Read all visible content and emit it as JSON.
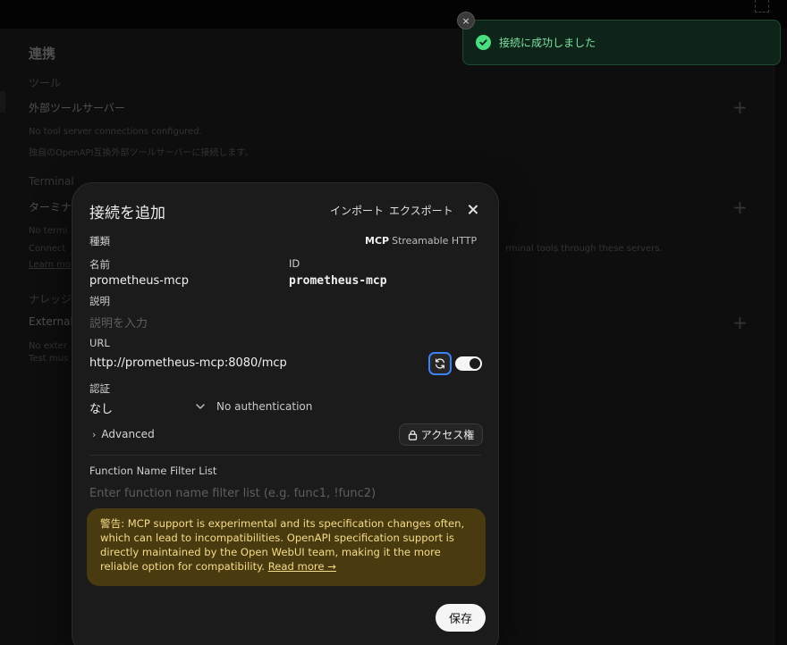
{
  "background": {
    "page_title": "連携",
    "section_tools": "ツール",
    "external_tool_servers_label": "外部ツールサーバー",
    "tools_empty": "No tool server connections configured.",
    "tools_desc": "独自のOpenAPI互換外部ツールサーバーに接続します。",
    "section_terminal": "Terminal",
    "terminal_label": "ターミナ",
    "terminal_empty": "No termi",
    "terminal_connect": "Connect",
    "terminal_desc_tail": "rminal tools through these servers.",
    "terminal_learn": "Learn mo",
    "section_knowledge": "ナレッジ",
    "external_label": "External",
    "external_empty": "No exter",
    "external_test": "Test mus"
  },
  "modal": {
    "title": "接続を追加",
    "import_label": "インポート",
    "export_label": "エクスポート",
    "type_label": "種類",
    "type_mcp": "MCP",
    "type_transport": "Streamable HTTP",
    "name_label": "名前",
    "name_value": "prometheus-mcp",
    "id_label": "ID",
    "id_value": "prometheus-mcp",
    "description_label": "説明",
    "description_placeholder": "説明を入力",
    "url_label": "URL",
    "url_value": "http://prometheus-mcp:8080/mcp",
    "url_enabled": true,
    "auth_label": "認証",
    "auth_value": "なし",
    "auth_detail": "No authentication",
    "advanced_label": "Advanced",
    "access_button": "アクセス権",
    "filter_label": "Function Name Filter List",
    "filter_placeholder": "Enter function name filter list (e.g. func1, !func2)",
    "warning_text": "警告: MCP support is experimental and its specification changes often, which can lead to incompatibilities. OpenAPI specification support is directly maintained by the Open WebUI team, making it the more reliable option for compatibility.",
    "warning_link": "Read more →",
    "save_button": "保存"
  },
  "toast": {
    "message": "接続に成功しました",
    "close_glyph": "×"
  },
  "colors": {
    "accent_focus": "#3b82f6",
    "success": "#4ade80",
    "warning_bg": "#4a3a10",
    "warning_text": "#f3dc8a"
  }
}
